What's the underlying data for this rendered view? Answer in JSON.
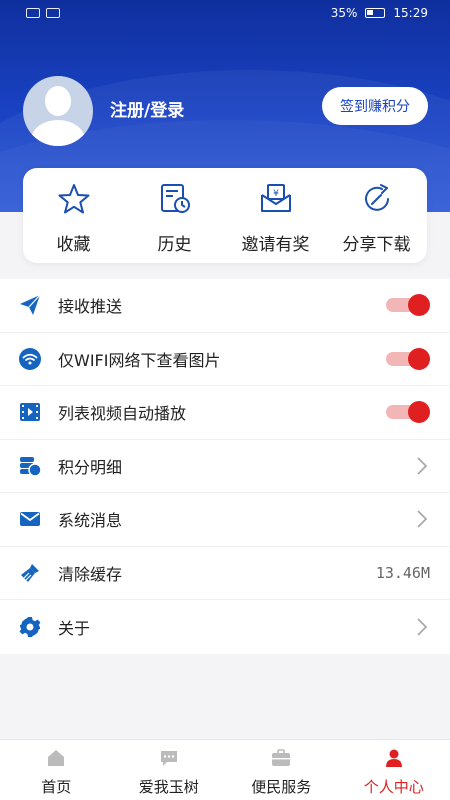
{
  "status_bar": {
    "battery": "35%",
    "time": "15:29"
  },
  "profile": {
    "login_label": "注册/登录",
    "checkin_label": "签到赚积分"
  },
  "quick_actions": [
    {
      "label": "收藏",
      "icon": "star-icon"
    },
    {
      "label": "历史",
      "icon": "history-icon"
    },
    {
      "label": "邀请有奖",
      "icon": "invite-envelope-icon"
    },
    {
      "label": "分享下载",
      "icon": "share-icon"
    }
  ],
  "settings": [
    {
      "label": "接收推送",
      "icon": "paper-plane-icon",
      "toggle": true
    },
    {
      "label": "仅WIFI网络下查看图片",
      "icon": "wifi-icon",
      "toggle": true
    },
    {
      "label": "列表视频自动播放",
      "icon": "video-icon",
      "toggle": true
    },
    {
      "label": "积分明细",
      "icon": "points-icon",
      "chevron": true
    },
    {
      "label": "系统消息",
      "icon": "mail-icon",
      "chevron": true
    },
    {
      "label": "清除缓存",
      "icon": "broom-icon",
      "value": "13.46M"
    },
    {
      "label": "关于",
      "icon": "gear-icon",
      "chevron": true
    }
  ],
  "tabs": [
    {
      "label": "首页",
      "icon": "home-icon",
      "active": false
    },
    {
      "label": "爱我玉树",
      "icon": "chat-icon",
      "active": false
    },
    {
      "label": "便民服务",
      "icon": "briefcase-icon",
      "active": false
    },
    {
      "label": "个人中心",
      "icon": "person-icon",
      "active": true
    }
  ],
  "colors": {
    "primary": "#1a43c4",
    "accent_red": "#e02020",
    "toggle_track": "#f3b6b6"
  }
}
